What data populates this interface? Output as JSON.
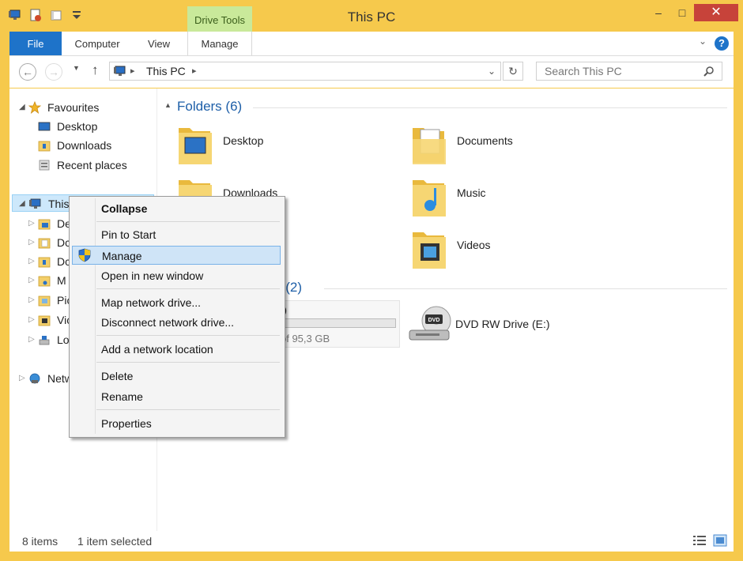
{
  "window": {
    "title": "This PC",
    "context_tab": "Drive Tools",
    "buttons": {
      "minimize": "–",
      "maximize": "□",
      "close": "✕"
    }
  },
  "ribbon": {
    "tabs": [
      "File",
      "Computer",
      "View",
      "Manage"
    ],
    "help": "?"
  },
  "navbar": {
    "address": "This PC",
    "search_placeholder": "Search This PC"
  },
  "sidebar": {
    "favourites": "Favourites",
    "favourite_items": [
      "Desktop",
      "Downloads",
      "Recent places"
    ],
    "this_pc": "This",
    "pc_items": [
      "De",
      "Dc",
      "Dc",
      "M",
      "Pic",
      "Vic",
      "Lo"
    ],
    "network": "Netw"
  },
  "content": {
    "folders_header": "Folders (6)",
    "folders": [
      "Desktop",
      "Documents",
      "Downloads",
      "Music",
      "Videos"
    ],
    "devices_header_fragment": "s (2)",
    "drive_label_fragment": ":)",
    "drive_free_fragment": "of 95,3 GB",
    "drive_usage_fraction": 0.03,
    "dvd_name": "DVD RW Drive (E:)",
    "dvd_badge": "DVD"
  },
  "context_menu": {
    "items": [
      {
        "label": "Collapse",
        "bold": true
      },
      {
        "label": "Pin to Start"
      },
      {
        "label": "Manage",
        "highlighted": true
      },
      {
        "label": "Open in new window"
      },
      {
        "label": "Map network drive..."
      },
      {
        "label": "Disconnect network drive..."
      },
      {
        "label": "Add a network location"
      },
      {
        "label": "Delete"
      },
      {
        "label": "Rename"
      },
      {
        "label": "Properties"
      }
    ]
  },
  "statusbar": {
    "items": "8 items",
    "selected": "1 item selected"
  },
  "colors": {
    "window_frame": "#f6c94c",
    "file_tab": "#1e73c9",
    "context_tab": "#c9e99a",
    "selection": "#cde8fb",
    "close_button": "#c7433a",
    "group_header": "#1e5fa8"
  }
}
